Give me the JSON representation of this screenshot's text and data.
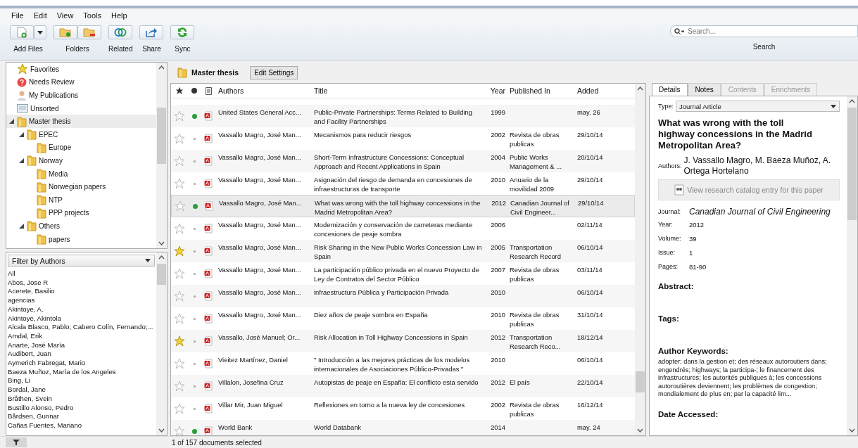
{
  "menu": [
    "File",
    "Edit",
    "View",
    "Tools",
    "Help"
  ],
  "toolbar": {
    "groups": [
      {
        "label": "Add Files",
        "kind": "addfiles"
      },
      {
        "label": "Folders",
        "kind": "folders"
      },
      {
        "label": "Related",
        "kind": "related"
      },
      {
        "label": "Share",
        "kind": "share"
      },
      {
        "label": "Sync",
        "kind": "sync"
      }
    ],
    "search": {
      "placeholder": "Search...",
      "label": "Search"
    }
  },
  "collections": [
    {
      "label": "Favorites",
      "kind": "star",
      "selected": false
    },
    {
      "label": "Needs Review",
      "kind": "review",
      "selected": false
    },
    {
      "label": "My Publications",
      "kind": "person",
      "selected": false
    },
    {
      "label": "Unsorted",
      "kind": "inbox",
      "selected": false
    },
    {
      "label": "Master thesis",
      "kind": "folder",
      "selected": true,
      "expanded": true,
      "children": [
        {
          "label": "EPEC",
          "kind": "folder",
          "selected": false,
          "expanded": true,
          "children": [
            {
              "label": "Europe",
              "kind": "folder",
              "selected": false
            }
          ]
        },
        {
          "label": "Norway",
          "kind": "folder",
          "selected": false,
          "expanded": true,
          "children": [
            {
              "label": "Media",
              "kind": "folder",
              "selected": false
            },
            {
              "label": "Norwegian papers",
              "kind": "folder",
              "selected": false
            },
            {
              "label": "NTP",
              "kind": "folder",
              "selected": false
            },
            {
              "label": "PPP projects",
              "kind": "folder",
              "selected": false
            }
          ]
        },
        {
          "label": "Others",
          "kind": "folder",
          "selected": false,
          "expanded": true,
          "children": [
            {
              "label": "papers",
              "kind": "folder",
              "selected": false
            }
          ]
        }
      ]
    }
  ],
  "filter": {
    "label": "Filter by Authors",
    "items": [
      "All",
      "Abos, Jose R",
      "Acerete, Basilio",
      "agencias",
      "Akintoye, A.",
      "Akintoye, Akintola",
      "Alcala Blasco, Pablo; Cabero Colín, Fernando;...",
      "Amdal, Erik",
      "Anarte, José María",
      "Audibert, Juan",
      "Aymerich Fabregat, Mario",
      "Baeza Muñoz, María de los Angeles",
      "Bing, Li",
      "Bordal, Jane",
      "Bråthen, Svein",
      "Bustillo Alonso, Pedro",
      "Bårdsen, Gunnar",
      "Cañas Fuentes, Mariano"
    ]
  },
  "folder_title": "Master thesis",
  "edit_settings": "Edit Settings",
  "table": {
    "columns": [
      "Authors",
      "Title",
      "Year",
      "Published In",
      "Added"
    ],
    "rows": [
      {
        "favorite": false,
        "unread": true,
        "authors": "United States General Acc...",
        "title": "Public-Private Partnerships: Terms Related to Building and Facility Partnerships",
        "year": "1999",
        "published_in": "",
        "added": "may. 26",
        "selected": false
      },
      {
        "favorite": false,
        "unread": false,
        "authors": "Vassallo Magro, José Man...",
        "title": "Mecanismos para reducir riesgos",
        "year": "2002",
        "published_in": "Revista de obras publicas",
        "added": "29/10/14",
        "selected": false
      },
      {
        "favorite": false,
        "unread": false,
        "authors": "Vassallo Magro, José Man...",
        "title": "Short-Term Infrastructure Concessions: Conceptual Approach and Recent Applications in Spain",
        "year": "2004",
        "published_in": "Public Works Management & ...",
        "added": "20/10/14",
        "selected": false
      },
      {
        "favorite": false,
        "unread": false,
        "authors": "Vassallo Magro, José Man...",
        "title": "Asignación del riesgo de demanda en concesiones de infraestructuras de transporte",
        "year": "2010",
        "published_in": "Anuario de la movilidad 2009",
        "added": "29/10/14",
        "selected": false
      },
      {
        "favorite": false,
        "unread": true,
        "authors": "Vassallo Magro, José Man...",
        "title": "What was wrong with the toll highway concessions in the Madrid Metropolitan Area?",
        "year": "2012",
        "published_in": "Canadian Journal of Civil Engineer...",
        "added": "29/10/14",
        "selected": true
      },
      {
        "favorite": false,
        "unread": false,
        "authors": "Vassallo Magro, José Man...",
        "title": "Modernización y conservación de carreteras mediante concesiones de peaje sombra",
        "year": "2006",
        "published_in": "",
        "added": "02/11/14",
        "selected": false
      },
      {
        "favorite": true,
        "unread": false,
        "authors": "Vassallo Magro, José Man...",
        "title": "Risk Sharing in the New Public Works Concession Law in Spain",
        "year": "2005",
        "published_in": "Transportation Research Record",
        "added": "06/10/14",
        "selected": false
      },
      {
        "favorite": false,
        "unread": false,
        "authors": "Vassallo Magro, José Man...",
        "title": "La participación público privada en el nuevo Proyecto de Ley de Contratos del Sector Público",
        "year": "2007",
        "published_in": "Revista de obras publicas",
        "added": "03/11/14",
        "selected": false
      },
      {
        "favorite": false,
        "unread": false,
        "authors": "Vassallo Magro, José Man...",
        "title": "infraestructura Pública y Participación Privada",
        "year": "2010",
        "published_in": "",
        "added": "06/10/14",
        "selected": false
      },
      {
        "favorite": false,
        "unread": false,
        "authors": "Vassallo Magro, José Man...",
        "title": "Diez años de peaje sombra en España",
        "year": "2010",
        "published_in": "Revista de obras publicas",
        "added": "31/10/14",
        "selected": false
      },
      {
        "favorite": true,
        "unread": false,
        "authors": "Vassallo, José Manuel; Or...",
        "title": "Risk Allocation in Toll Highway Concessions in Spain",
        "year": "2012",
        "published_in": "Transportation Research Reco...",
        "added": "18/12/14",
        "selected": false
      },
      {
        "favorite": false,
        "unread": false,
        "authors": "Vieitez Martínez, Daniel",
        "title": "\" Introducción a las mejores prácticas de los modelos internacionales de Asociaciones Público-Privadas \"",
        "year": "2010",
        "published_in": "",
        "added": "06/10/14",
        "selected": false
      },
      {
        "favorite": false,
        "unread": false,
        "authors": "Villalon, Josefina Cruz",
        "title": "Autopistas de peaje en España: El conflicto esta servido",
        "year": "2012",
        "published_in": "El país",
        "added": "22/10/14",
        "selected": false
      },
      {
        "favorite": false,
        "unread": false,
        "authors": "Villar Mir, Juan Miguel",
        "title": "Reflexiones en torno a la nueva ley de concesiones",
        "year": "2002",
        "published_in": "Revista de obras publicas",
        "added": "16/12/14",
        "selected": false
      },
      {
        "favorite": false,
        "unread": true,
        "authors": "World Bank",
        "title": "World Databank",
        "year": "2014",
        "published_in": "",
        "added": "may. 24",
        "selected": false
      }
    ]
  },
  "status": "1 of 157 documents selected",
  "details": {
    "tabs": [
      {
        "label": "Details",
        "selected": true,
        "disabled": false
      },
      {
        "label": "Notes",
        "selected": false,
        "disabled": false
      },
      {
        "label": "Contents",
        "selected": false,
        "disabled": true
      },
      {
        "label": "Enrichments",
        "selected": false,
        "disabled": true
      }
    ],
    "type_label": "Type:",
    "type_value": "Journal Article",
    "title": "What was wrong with the toll highway concessions in the Madrid Metropolitan Area?",
    "authors_label": "Authors:",
    "authors": "J. Vassallo Magro, M. Baeza Muñoz, A. Ortega Hortelano",
    "catalog_button": "View research catalog entry for this paper",
    "journal_label": "Journal:",
    "journal": "Canadian Journal of Civil Engineering",
    "fields": [
      {
        "label": "Year:",
        "value": "2012"
      },
      {
        "label": "Volume:",
        "value": "39"
      },
      {
        "label": "Issue:",
        "value": "1"
      },
      {
        "label": "Pages:",
        "value": "81-90"
      }
    ],
    "sections": [
      {
        "heading": "Abstract:"
      },
      {
        "heading": "Tags:"
      },
      {
        "heading": "Author Keywords:",
        "text": "adopter; dans la gestion et; des réseaux autoroutiers dans; engendrés; highways; la participa-; le financement des infrastructures; les autorités publiques à; les concessions autoroutières deviennent; les problèmes de congestion; mondialement de plus en; par la capacité lim..."
      },
      {
        "heading": "Date Accessed:"
      }
    ]
  }
}
